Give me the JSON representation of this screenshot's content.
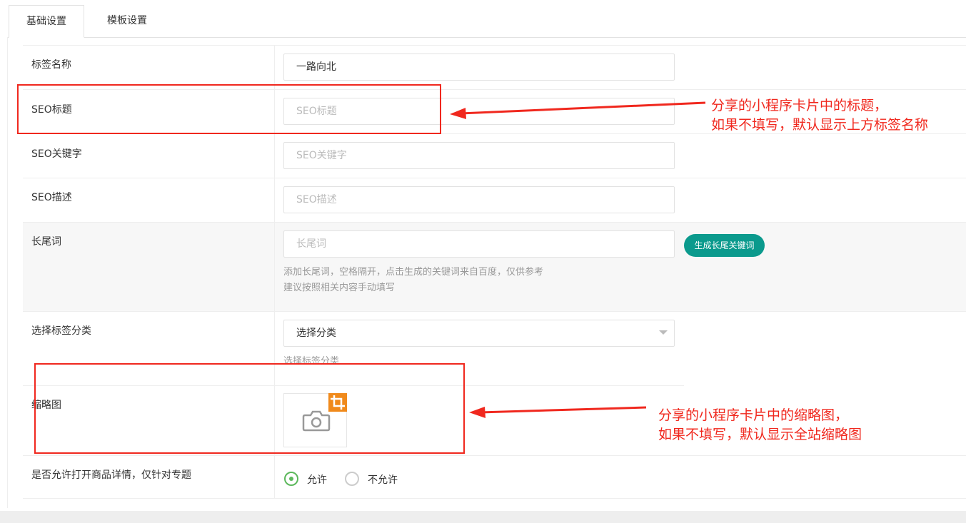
{
  "tabs": [
    {
      "label": "基础设置",
      "active": true
    },
    {
      "label": "模板设置",
      "active": false
    }
  ],
  "form": {
    "tag_name": {
      "label": "标签名称",
      "value": "一路向北"
    },
    "seo_title": {
      "label": "SEO标题",
      "placeholder": "SEO标题"
    },
    "seo_keywords": {
      "label": "SEO关键字",
      "placeholder": "SEO关键字"
    },
    "seo_desc": {
      "label": "SEO描述",
      "placeholder": "SEO描述"
    },
    "long_tail": {
      "label": "长尾词",
      "placeholder": "长尾词",
      "button": "生成长尾关键词",
      "hint1": "添加长尾词，空格隔开，点击生成的关键词来自百度，仅供参考",
      "hint2": "建议按照相关内容手动填写"
    },
    "category": {
      "label": "选择标签分类",
      "selected": "选择分类",
      "hint": "选择标签分类"
    },
    "thumbnail": {
      "label": "缩略图"
    },
    "allow_detail": {
      "label": "是否允许打开商品详情，仅针对专题",
      "options": [
        {
          "label": "允许",
          "checked": true
        },
        {
          "label": "不允许",
          "checked": false
        }
      ]
    }
  },
  "annotations": {
    "seo_title_note": [
      "分享的小程序卡片中的标题，",
      "如果不填写，默认显示上方标签名称"
    ],
    "thumbnail_note": [
      "分享的小程序卡片中的缩略图，",
      "如果不填写，默认显示全站缩略图"
    ],
    "color": "#f0281e"
  },
  "colors": {
    "accent_green": "#0b9a8d",
    "radio_green": "#5cb85c",
    "crop_orange": "#f08a1c"
  },
  "icons": [
    "camera-icon",
    "crop-icon",
    "dropdown-caret-icon"
  ]
}
